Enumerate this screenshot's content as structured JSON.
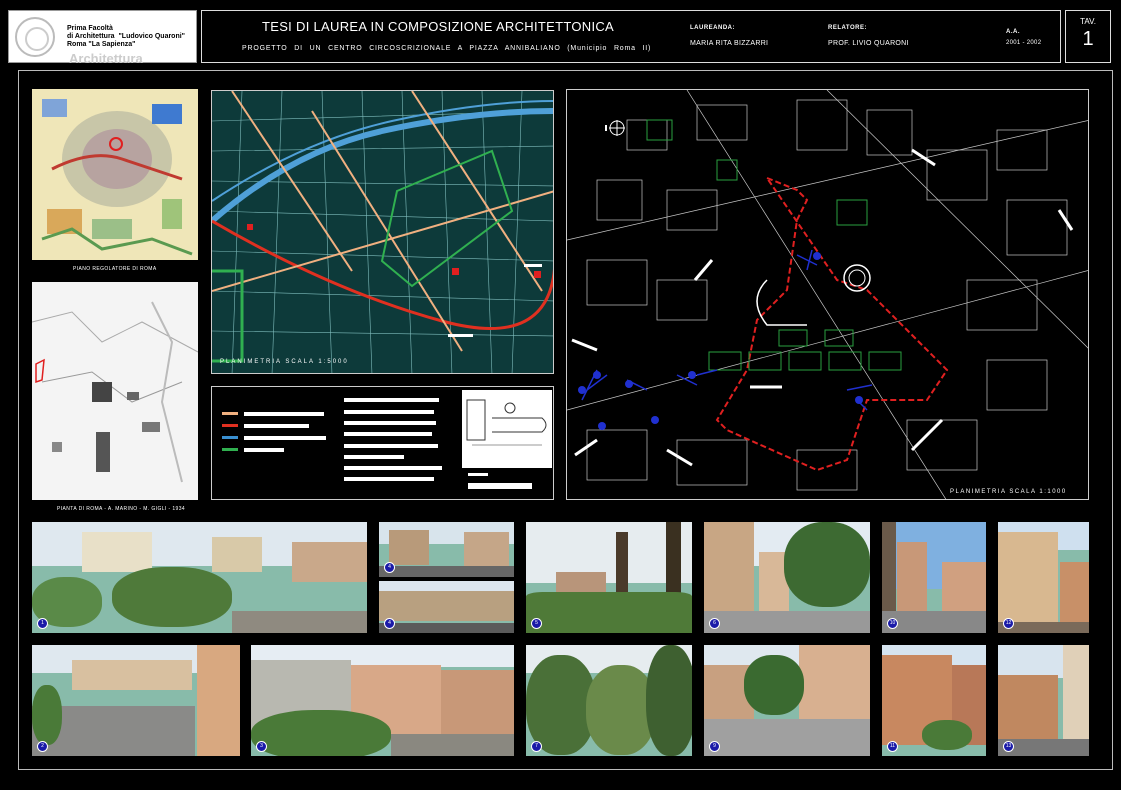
{
  "header": {
    "school_line1": "Prima Facoltà",
    "school_line2": "di Architettura  \"Ludovico Quaroni\"",
    "school_line3": "Roma \"La Sapienza\"",
    "school_logo_word": "Architettura",
    "title": "TESI DI LAUREA IN COMPOSIZIONE ARCHITETTONICA",
    "subtitle": "PROGETTO DI UN CENTRO CIRCOSCRIZIONALE A PIAZZA ANNIBALIANO (Municipio Roma II)",
    "laureanda_label": "LAUREANDA:",
    "laureanda_name": "MARIA RITA BIZZARRI",
    "relatore_label": "RELATORE:",
    "relatore_name": "PROF. LIVIO QUARONI",
    "aa_label": "A.A.",
    "aa_value": "2001 - 2002",
    "tav_label": "TAV.",
    "tav_number": "1"
  },
  "captions": {
    "piano": "PIANO REGOLATORE DI ROMA",
    "pianta": "PIANTA DI ROMA   -   A. MARINO - M. GIGLI - 1934",
    "planimetria_5000": "PLANIMETRIA  SCALA  1:5000",
    "planimetria_1000": "PLANIMETRIA  SCALA  1:1000"
  },
  "legend": {
    "colors": [
      "#f0b080",
      "#e03020",
      "#3a8fd0",
      "#30b050"
    ]
  },
  "colors": {
    "background": "#000000",
    "map_dark": "#0b3b3b",
    "boundary_red": "#e02020",
    "green_area": "#2aa040",
    "road_light": "#f0c090",
    "photo_marker": "#1a1aa8"
  },
  "photos": [
    {
      "num": "1"
    },
    {
      "num": "4"
    },
    {
      "num": "5"
    },
    {
      "num": "6"
    },
    {
      "num": "8"
    },
    {
      "num": "10"
    },
    {
      "num": "12"
    },
    {
      "num": "2"
    },
    {
      "num": "3"
    },
    {
      "num": "7"
    },
    {
      "num": "9"
    },
    {
      "num": "11"
    },
    {
      "num": "13"
    }
  ]
}
